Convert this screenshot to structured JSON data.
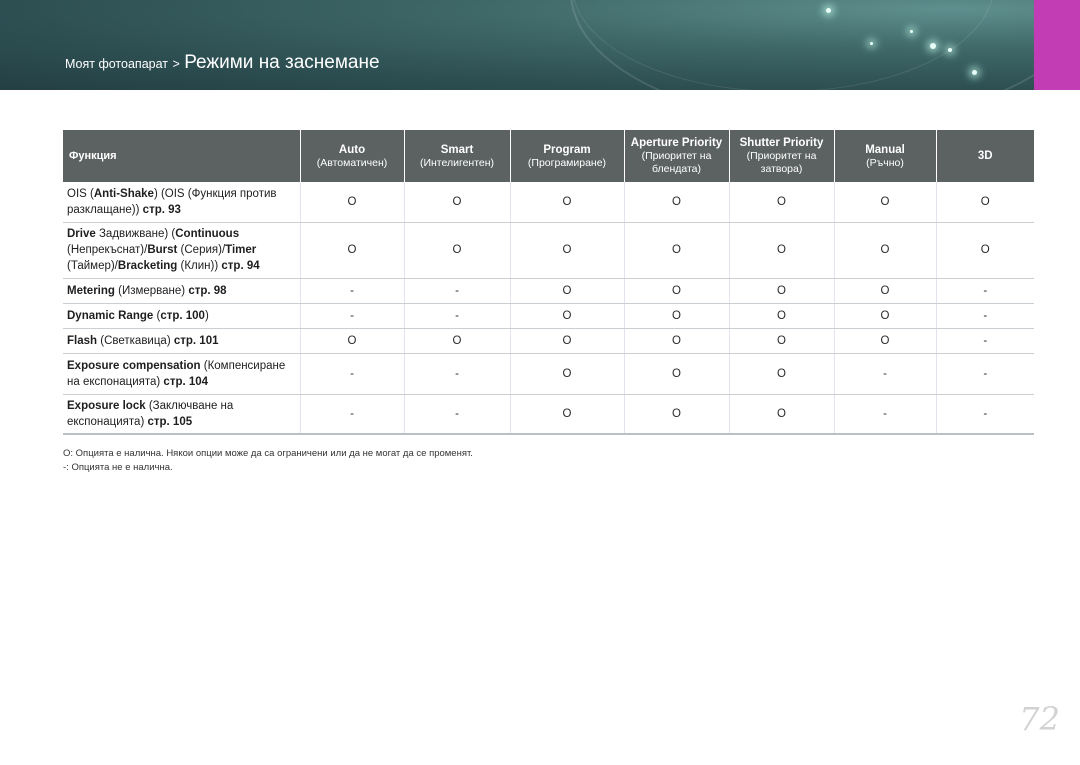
{
  "header": {
    "crumb_parent": "Моят фотоапарат",
    "crumb_sep": ">",
    "crumb_title": "Режими на заснемане"
  },
  "table": {
    "columns": [
      {
        "line1": "Функция",
        "line2": ""
      },
      {
        "line1": "Auto",
        "line2": "(Автоматичен)"
      },
      {
        "line1": "Smart",
        "line2": "(Интелигентен)"
      },
      {
        "line1": "Program",
        "line2": "(Програмиране)"
      },
      {
        "line1": "Aperture Priority",
        "line2": "(Приоритет на",
        "line3": "блендата)"
      },
      {
        "line1": "Shutter Priority",
        "line2": "(Приоритет на",
        "line3": "затвора)"
      },
      {
        "line1": "Manual",
        "line2": "(Ръчно)"
      },
      {
        "line1": "3D",
        "line2": ""
      }
    ],
    "rows": [
      {
        "label_parts": [
          {
            "t": "OIS ",
            "b": false
          },
          {
            "t": "(",
            "b": false
          },
          {
            "t": "Anti-Shake",
            "b": true
          },
          {
            "t": ") (OIS (Функция против разклащане)) ",
            "b": false
          },
          {
            "t": "стр. 93",
            "b": true
          }
        ],
        "values": [
          "O",
          "O",
          "O",
          "O",
          "O",
          "O",
          "O"
        ]
      },
      {
        "label_parts": [
          {
            "t": "Drive",
            "b": true
          },
          {
            "t": " Задвижване) (",
            "b": false
          },
          {
            "t": "Continuous",
            "b": true
          },
          {
            "t": " (Непрекъснат)/",
            "b": false
          },
          {
            "t": "Burst",
            "b": true
          },
          {
            "t": " (Серия)/",
            "b": false
          },
          {
            "t": "Timer",
            "b": true
          },
          {
            "t": " (Таймер)/",
            "b": false
          },
          {
            "t": "Bracketing",
            "b": true
          },
          {
            "t": " (Клин)) ",
            "b": false
          },
          {
            "t": "стр. 94",
            "b": true
          }
        ],
        "values": [
          "O",
          "O",
          "O",
          "O",
          "O",
          "O",
          "O"
        ]
      },
      {
        "label_parts": [
          {
            "t": "Metering",
            "b": true
          },
          {
            "t": " (Измерване) ",
            "b": false
          },
          {
            "t": "стр. 98",
            "b": true
          }
        ],
        "values": [
          "-",
          "-",
          "O",
          "O",
          "O",
          "O",
          "-"
        ]
      },
      {
        "label_parts": [
          {
            "t": "Dynamic Range",
            "b": true
          },
          {
            "t": " (",
            "b": false
          },
          {
            "t": "стр. 100",
            "b": true
          },
          {
            "t": ")",
            "b": false
          }
        ],
        "values": [
          "-",
          "-",
          "O",
          "O",
          "O",
          "O",
          "-"
        ]
      },
      {
        "label_parts": [
          {
            "t": "Flash",
            "b": true
          },
          {
            "t": " (Светкавица) ",
            "b": false
          },
          {
            "t": "стр. 101",
            "b": true
          }
        ],
        "values": [
          "O",
          "O",
          "O",
          "O",
          "O",
          "O",
          "-"
        ]
      },
      {
        "label_parts": [
          {
            "t": "Exposure compensation",
            "b": true
          },
          {
            "t": " (Компенсиране на експонацията) ",
            "b": false
          },
          {
            "t": "стр. 104",
            "b": true
          }
        ],
        "values": [
          "-",
          "-",
          "O",
          "O",
          "O",
          "-",
          "-"
        ]
      },
      {
        "label_parts": [
          {
            "t": "Exposure lock",
            "b": true
          },
          {
            "t": " (Заключване на експонацията) ",
            "b": false
          },
          {
            "t": "стр. 105",
            "b": true
          }
        ],
        "values": [
          "-",
          "-",
          "O",
          "O",
          "O",
          "-",
          "-"
        ]
      }
    ]
  },
  "notes": {
    "available": "O: Опцията е налична. Някои опции може да са ограничени или да не могат да се променят.",
    "unavailable": "-: Опцията не е налична."
  },
  "page_number": "72",
  "colors": {
    "header_band": "#2d4f52",
    "accent_tab": "#c23db3",
    "table_header": "#5c6261"
  }
}
